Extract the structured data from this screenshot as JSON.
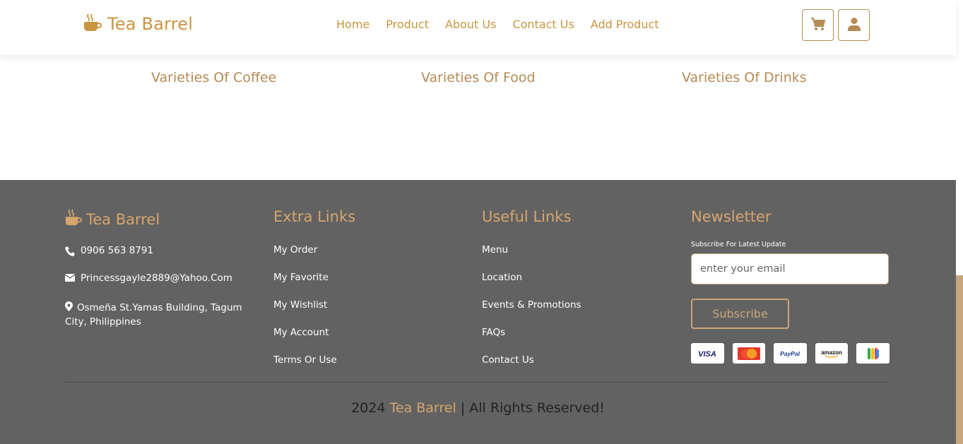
{
  "header": {
    "brand": "Tea Barrel",
    "nav": [
      "Home",
      "Product",
      "About Us",
      "Contact Us",
      "Add Product"
    ],
    "cart_icon": "cart-icon",
    "user_icon": "user-icon"
  },
  "varieties": [
    "Varieties Of Coffee",
    "Varieties Of Food",
    "Varieties Of Drinks"
  ],
  "footer": {
    "brand": "Tea Barrel",
    "contact": {
      "phone": "0906 563 8791",
      "email": "Princessgayle2889@Yahoo.Com",
      "address": "Osmeña St.Yamas Building, Tagum City, Philippines"
    },
    "extra_links": {
      "title": "Extra Links",
      "items": [
        "My Order",
        "My Favorite",
        "My Wishlist",
        "My Account",
        "Terms Or Use"
      ]
    },
    "useful_links": {
      "title": "Useful Links",
      "items": [
        "Menu",
        "Location",
        "Events & Promotions",
        "FAQs",
        "Contact Us"
      ]
    },
    "newsletter": {
      "title": "Newsletter",
      "caption": "Subscribe For Latest Update",
      "placeholder": "enter your email",
      "button": "Subscribe",
      "payments": [
        "VISA",
        "mastercard",
        "PayPal",
        "amazon",
        "gpay"
      ]
    },
    "copyright": {
      "year": "2024",
      "brand": "Tea Barrel",
      "suffix": "| All Rights Reserved!"
    }
  },
  "colors": {
    "accent": "#c9953f",
    "footer_bg": "#626262",
    "footer_heading": "#d7a56c"
  }
}
